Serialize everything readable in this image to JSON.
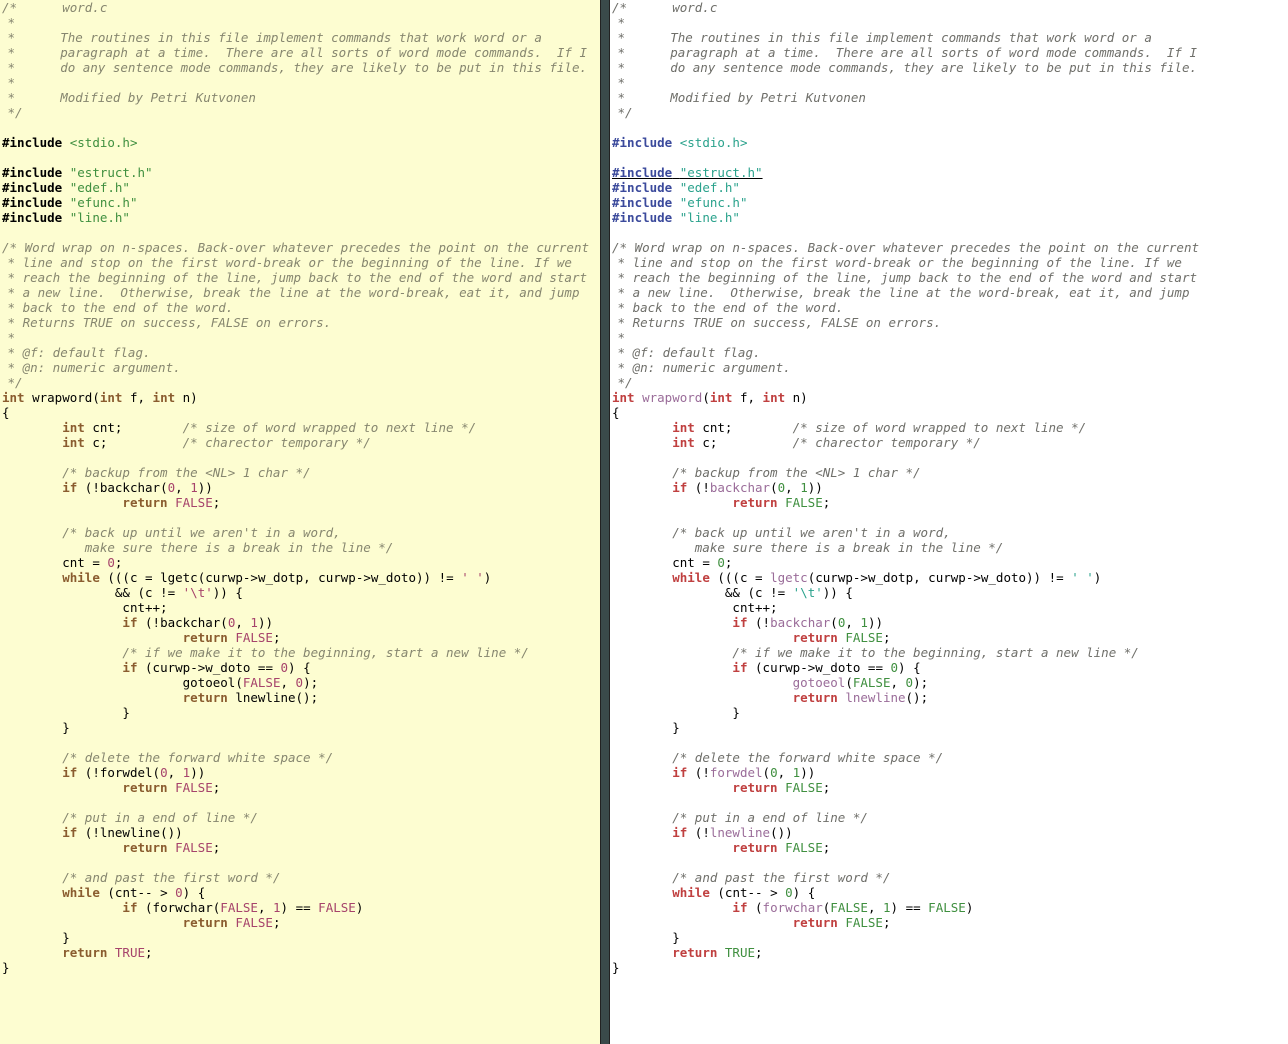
{
  "file": {
    "name_comment": "word.c",
    "header_block": "/*      word.c\n *\n *      The routines in this file implement commands that work word or a\n *      paragraph at a time.  There are all sorts of word mode commands.  If I\n *      do any sentence mode commands, they are likely to be put in this file.\n *\n *      Modified by Petri Kutvonen\n */",
    "includes": {
      "system": [
        "<stdio.h>"
      ],
      "local": [
        "\"estruct.h\"",
        "\"edef.h\"",
        "\"efunc.h\"",
        "\"line.h\""
      ]
    },
    "fn_comment": "/* Word wrap on n-spaces. Back-over whatever precedes the point on the current\n * line and stop on the first word-break or the beginning of the line. If we\n * reach the beginning of the line, jump back to the end of the word and start\n * a new line.  Otherwise, break the line at the word-break, eat it, and jump\n * back to the end of the word.\n * Returns TRUE on success, FALSE on errors.\n *\n * @f: default flag.\n * @n: numeric argument.\n */",
    "fn_sig": {
      "ret": "int",
      "name": "wrapword",
      "params": "int f, int n"
    },
    "decl": {
      "cnt": {
        "type": "int",
        "name": "cnt",
        "comment": "/* size of word wrapped to next line */"
      },
      "c": {
        "type": "int",
        "name": "c",
        "comment": "/* charector temporary */"
      }
    },
    "comments": {
      "backup_nl": "/* backup from the <NL> 1 char */",
      "back_up_word": "/* back up until we aren't in a word,\n           make sure there is a break in the line */",
      "beginning": "/* if we make it to the beginning, start a new line */",
      "delete_ws": "/* delete the forward white space */",
      "put_eol": "/* put in a end of line */",
      "past_first": "/* and past the first word */"
    },
    "literals": {
      "zero": "0",
      "one": "1",
      "space_char": "' '",
      "tab_char": "'\\t'",
      "FALSE": "FALSE",
      "TRUE": "TRUE"
    },
    "idents": {
      "backchar": "backchar",
      "forwdel": "forwdel",
      "lnewline": "lnewline",
      "forwchar": "forwchar",
      "gotoeol": "gotoeol",
      "lgetc": "lgetc",
      "curwp": "curwp",
      "w_dotp": "w_dotp",
      "w_doto": "w_doto",
      "cnt": "cnt",
      "c": "c"
    },
    "keywords": {
      "include": "#include",
      "int": "int",
      "if": "if",
      "return": "return",
      "while": "while"
    }
  }
}
